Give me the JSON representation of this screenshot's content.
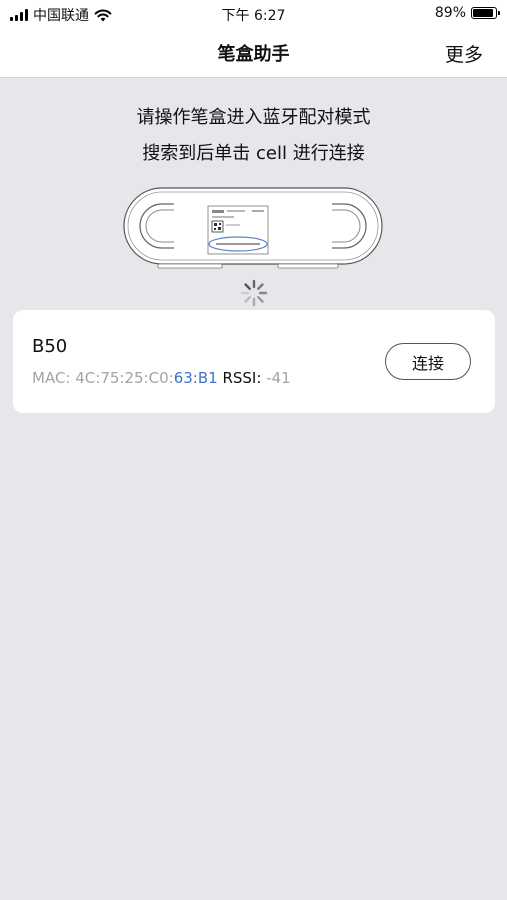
{
  "status_bar": {
    "carrier": "中国联通",
    "time": "下午 6:27",
    "battery": "89%",
    "battery_level": 0.89
  },
  "nav": {
    "title": "笔盒助手",
    "more": "更多"
  },
  "instructions": {
    "line1": "请操作笔盒进入蓝牙配对模式",
    "line2": "搜索到后单击 cell 进行连接"
  },
  "devices": [
    {
      "name": "B50",
      "mac_label": "MAC:",
      "mac_prefix": "4C:75:25:C0:",
      "mac_suffix": "63:B1",
      "rssi_label": "RSSI:",
      "rssi_value": "-41",
      "connect_label": "连接"
    }
  ],
  "colors": {
    "background": "#e6e6eb",
    "mac_highlight": "#3f73c9",
    "card": "#ffffff"
  }
}
